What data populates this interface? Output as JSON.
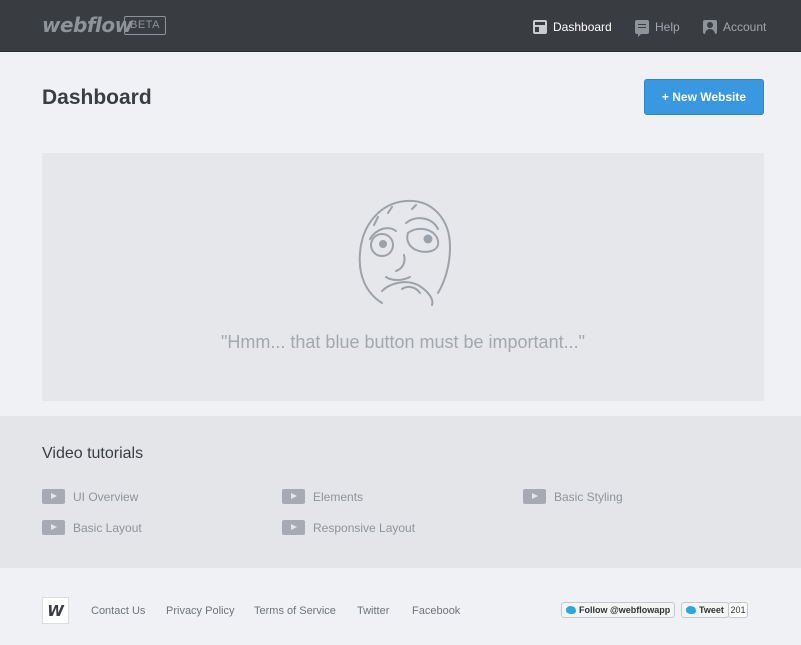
{
  "header": {
    "logo_text": "webflow",
    "beta_label": "BETA",
    "nav": [
      {
        "label": "Dashboard",
        "icon": "dashboard-icon",
        "active": true
      },
      {
        "label": "Help",
        "icon": "help-icon",
        "active": false
      },
      {
        "label": "Account",
        "icon": "account-icon",
        "active": false
      }
    ]
  },
  "main": {
    "title": "Dashboard",
    "new_button_label": "+ New Website",
    "empty_state": {
      "illustration": "thinking-face-meme",
      "message": "\"Hmm... that blue button must be important...\""
    }
  },
  "tutorials": {
    "title": "Video tutorials",
    "items": [
      {
        "label": "UI Overview"
      },
      {
        "label": "Elements"
      },
      {
        "label": "Basic Styling"
      },
      {
        "label": "Basic Layout"
      },
      {
        "label": "Responsive Layout"
      }
    ]
  },
  "footer": {
    "logo_text": "W",
    "links": [
      {
        "label": "Contact Us"
      },
      {
        "label": "Privacy Policy"
      },
      {
        "label": "Terms of Service"
      },
      {
        "label": "Twitter"
      },
      {
        "label": "Facebook"
      }
    ],
    "follow_label": "Follow @webflowapp",
    "tweet_label": "Tweet",
    "tweet_count": "201"
  },
  "colors": {
    "topbar": "#393c40",
    "accent_blue": "#3a98e0",
    "background": "#f0f1f4"
  }
}
